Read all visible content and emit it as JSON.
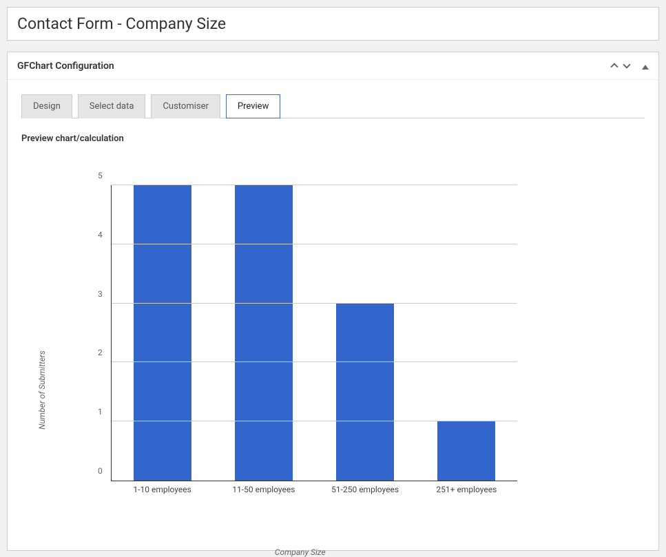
{
  "page": {
    "title": "Contact Form - Company Size"
  },
  "metabox": {
    "title": "GFChart Configuration"
  },
  "tabs": [
    {
      "label": "Design",
      "active": false
    },
    {
      "label": "Select data",
      "active": false
    },
    {
      "label": "Customiser",
      "active": false
    },
    {
      "label": "Preview",
      "active": true
    }
  ],
  "content": {
    "preview_label": "Preview chart/calculation"
  },
  "chart_data": {
    "type": "bar",
    "categories": [
      "1-10 employees",
      "11-50 employees",
      "51-250 employees",
      "251+ employees"
    ],
    "values": [
      5,
      5,
      3,
      1
    ],
    "title": "",
    "xlabel": "Company Size",
    "ylabel": "Number of Submitters",
    "ylim": [
      0,
      5
    ],
    "yticks": [
      0,
      1,
      2,
      3,
      4,
      5
    ],
    "bar_color": "#3366cc"
  }
}
